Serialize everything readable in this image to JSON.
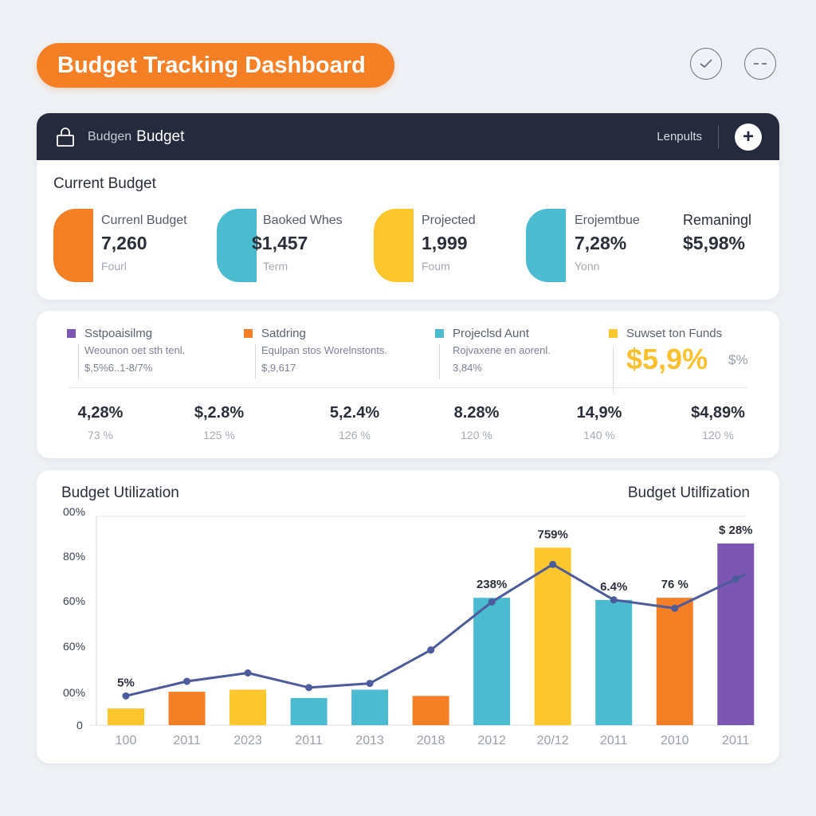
{
  "header": {
    "title": "Budget Tracking Dashboard",
    "check_icon": "check-icon",
    "more_icon": "more-icon"
  },
  "topbar": {
    "prefix": "Budgen",
    "title": "Budget",
    "link": "Lenpults",
    "plus": "+"
  },
  "current": {
    "title": "Current Budget",
    "stats": [
      {
        "label": "Currenl Budget",
        "value": "7,260",
        "sub": "Fourl",
        "color": "#f47f25"
      },
      {
        "label": "Baoked Whes",
        "value": "$1,457",
        "sub": "Term",
        "color": "#4bbccf"
      },
      {
        "label": "Projected",
        "value": "1,999",
        "sub": "Foum",
        "color": "#fbc72c"
      },
      {
        "label": "Erojemtbue",
        "value": "7,28%",
        "sub": "Yonn",
        "color": "#4bbccf"
      },
      {
        "label": "Remaningl",
        "value": "$5,98%",
        "sub": "",
        "color": ""
      }
    ]
  },
  "legend": {
    "items": [
      {
        "name": "Sstpoaisilmg",
        "desc": "Weounon oet sth tenl.",
        "value": "$,5%6..1-8/7%",
        "color": "#7b57b3"
      },
      {
        "name": "Satdring",
        "desc": "Equlpan stos Worelnstonts.",
        "value": "$,9,617",
        "color": "#f47f25"
      },
      {
        "name": "Projeclsd Aunt",
        "desc": "Rojvaxene en aorenl.",
        "value": "3,84%",
        "color": "#4bbccf"
      },
      {
        "name": "Suwset ton Funds",
        "desc": "",
        "value": "",
        "color": "#fbc72c"
      }
    ],
    "big_value": "$5,9%",
    "big_unit": "$%"
  },
  "metrics": [
    {
      "value": "4,28%",
      "sub": "73 %"
    },
    {
      "value": "$,2.8%",
      "sub": "125 %"
    },
    {
      "value": "5,2.4%",
      "sub": "126 %"
    },
    {
      "value": "8.28%",
      "sub": "120 %"
    },
    {
      "value": "14,9%",
      "sub": "140 %"
    },
    {
      "value": "$4,89%",
      "sub": "120 %"
    }
  ],
  "utilization": {
    "title_left": "Budget Utilization",
    "title_right": "Budget Utilfization"
  },
  "chart_data": {
    "type": "bar",
    "y_tick_labels": [
      "0",
      "00%",
      "60%",
      "60%",
      "80%",
      "00%"
    ],
    "ylim": [
      0,
      100
    ],
    "categories": [
      "100",
      "2011",
      "2023",
      "2011",
      "2013",
      "2018",
      "2012",
      "20/12",
      "2011",
      "2010",
      "2011"
    ],
    "bar_values": [
      8,
      16,
      17,
      13,
      17,
      14,
      61,
      85,
      60,
      61,
      87
    ],
    "bar_colors": [
      "#fbc72c",
      "#f47f25",
      "#fbc72c",
      "#4bbccf",
      "#4bbccf",
      "#f47f25",
      "#4bbccf",
      "#fbc72c",
      "#4bbccf",
      "#f47f25",
      "#7b57b3"
    ],
    "line_values": [
      14,
      21,
      25,
      18,
      20,
      36,
      59,
      77,
      60,
      56,
      70
    ],
    "line_extra_end": 70,
    "data_labels": [
      {
        "index": 0,
        "text": "5%"
      },
      {
        "index": 6,
        "text": "238%"
      },
      {
        "index": 7,
        "text": "759%"
      },
      {
        "index": 8,
        "text": "6.4%"
      },
      {
        "index": 9,
        "text": "76 %"
      },
      {
        "index": 10,
        "text": "$ 28%"
      }
    ],
    "grid": false,
    "line_color": "#4d5b9c"
  }
}
